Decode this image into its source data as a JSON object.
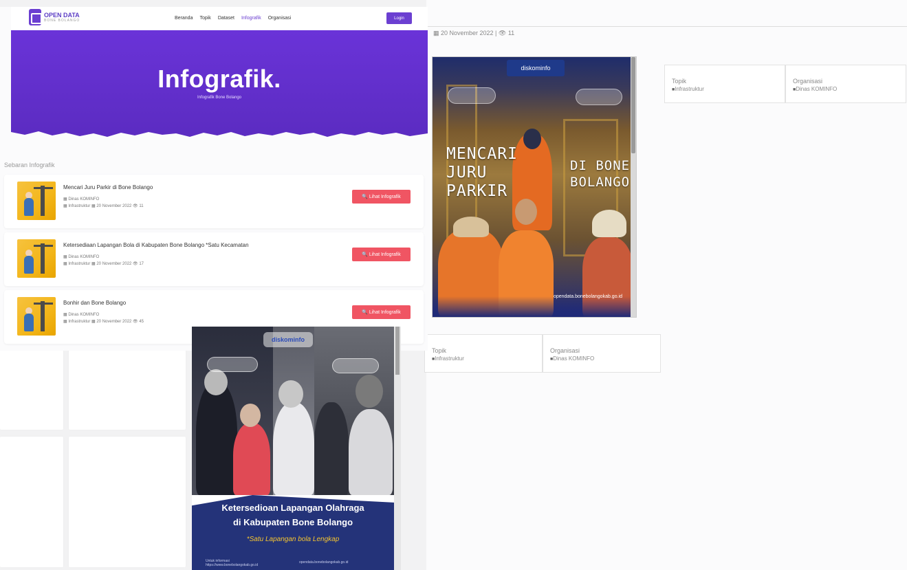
{
  "detail_page": {
    "meta": "▦ 20 November 2022 | 👁 11",
    "poster": {
      "brand": "diskominfo",
      "title_left": [
        "MENCARI",
        "JURU",
        "PARKIR"
      ],
      "title_right": [
        "DI BONE",
        "BOLANGO"
      ],
      "url": "opendata.bonebolangokab.go.id"
    },
    "info_top": [
      {
        "label": "Topik",
        "value": "Infrastruktur"
      },
      {
        "label": "Organisasi",
        "value": "Dinas KOMINFO"
      }
    ],
    "info_bottom": [
      {
        "label": "Topik",
        "value": "Infrastruktur"
      },
      {
        "label": "Organisasi",
        "value": "Dinas KOMINFO"
      }
    ]
  },
  "list_page": {
    "logo_text": "OPEN DATA",
    "logo_sub": "BONE BOLANGO",
    "menu": [
      "Beranda",
      "Topik",
      "Dataset",
      "Infografik",
      "Organisasi"
    ],
    "menu_active": "Infografik",
    "login_label": "Login",
    "hero_title": "Infografik.",
    "hero_subtitle": "Infografik Bone Bolango",
    "section_title": "Sebaran Infografik",
    "items": [
      {
        "title": "Mencari Juru Parkir di Bone Bolango",
        "org": "▦ Dinas KOMINFO",
        "meta": "▦ Infrastruktur  ▦ 20 November 2022  👁 11",
        "button": "🔍 Lihat Infografik"
      },
      {
        "title": "Ketersediaan Lapangan Bola di Kabupaten Bone Bolango *Satu Kecamatan",
        "org": "▦ Dinas KOMINFO",
        "meta": "▦ Infrastruktur  ▦ 20 November 2022  👁 17",
        "button": "🔍 Lihat Infografik"
      },
      {
        "title": "Bonhir dan Bone Bolango",
        "org": "▦ Dinas KOMINFO",
        "meta": "▦ Infrastruktur  ▦ 20 November 2022  👁 45",
        "button": "🔍 Lihat Infografik"
      }
    ]
  },
  "bottom_poster": {
    "brand": "diskominfo",
    "title_line1": "Ketersedioan Lapangan Olahraga",
    "title_line2": "di Kabupaten Bone Bolango",
    "tagline": "*Satu Lapangan bola Lengkap",
    "foot_left": "Untuk informasi\nhttps://www.bonebolangokab.go.id",
    "foot_right": "opendata.bonebolangokab.go.id"
  }
}
